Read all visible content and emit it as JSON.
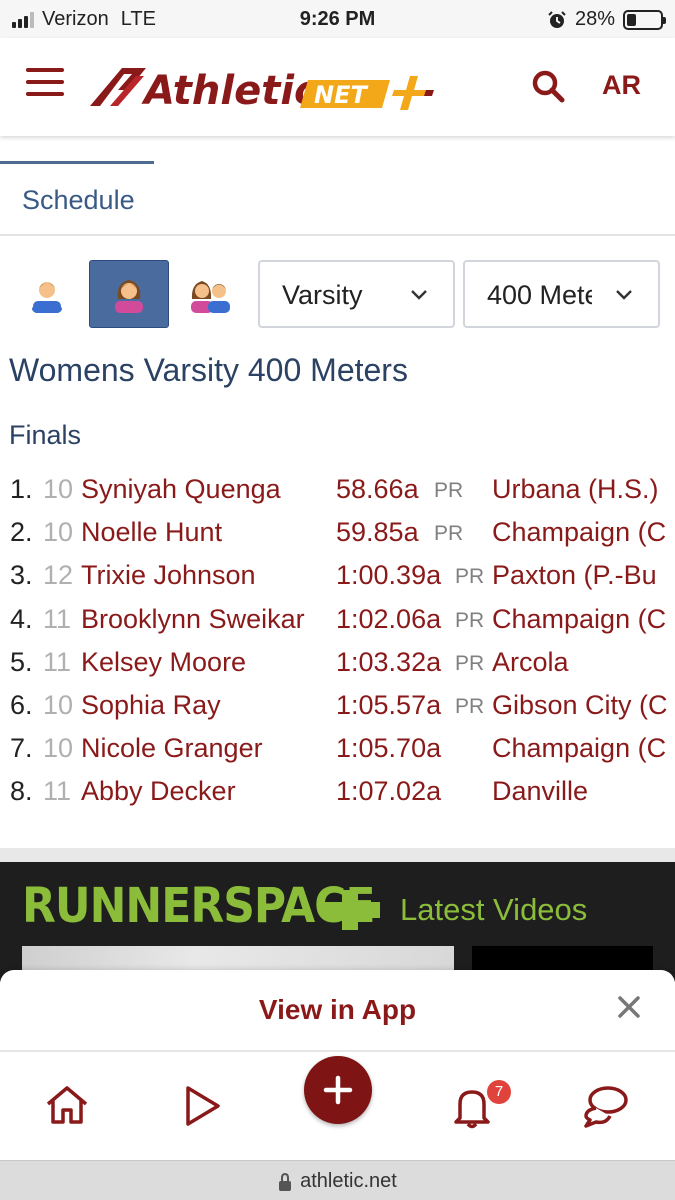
{
  "status_bar": {
    "carrier": "Verizon",
    "network": "LTE",
    "time": "9:26 PM",
    "battery": "28%",
    "battery_level": 0.28
  },
  "header": {
    "logo_athletic": "Athletic",
    "logo_net": "NET",
    "user_initials": "AR",
    "colors": {
      "brand": "#8a1a1a",
      "gold": "#f2a818"
    }
  },
  "tabs": [
    {
      "label": "Schedule"
    }
  ],
  "filters": {
    "gender_selected": "women",
    "level": "Varsity",
    "event": "400 Meters"
  },
  "event_title": "Womens Varsity 400 Meters",
  "section": "Finals",
  "results": [
    {
      "place": "1.",
      "grade": "10",
      "name": "Syniyah Quenga",
      "time": "58.66a",
      "pr": "PR",
      "team": "Urbana (H.S.)"
    },
    {
      "place": "2.",
      "grade": "10",
      "name": "Noelle Hunt",
      "time": "59.85a",
      "pr": "PR",
      "team": "Champaign (C"
    },
    {
      "place": "3.",
      "grade": "12",
      "name": "Trixie Johnson",
      "time": "1:00.39a",
      "pr": "PR",
      "team": "Paxton (P.-Bu"
    },
    {
      "place": "4.",
      "grade": "11",
      "name": "Brooklynn Sweikar",
      "time": "1:02.06a",
      "pr": "PR",
      "team": "Champaign (C"
    },
    {
      "place": "5.",
      "grade": "11",
      "name": "Kelsey Moore",
      "time": "1:03.32a",
      "pr": "PR",
      "team": "Arcola"
    },
    {
      "place": "6.",
      "grade": "10",
      "name": "Sophia Ray",
      "time": "1:05.57a",
      "pr": "PR",
      "team": "Gibson City (C"
    },
    {
      "place": "7.",
      "grade": "10",
      "name": "Nicole Granger",
      "time": "1:05.70a",
      "pr": "",
      "team": "Champaign (C"
    },
    {
      "place": "8.",
      "grade": "11",
      "name": "Abby Decker",
      "time": "1:07.02a",
      "pr": "",
      "team": "Danville"
    }
  ],
  "runnerspace": {
    "logo": "RUNNERSPACE",
    "heading": "Latest Videos",
    "accent": "#8bbd3a"
  },
  "app_banner": {
    "label": "View in App"
  },
  "bottom_nav": {
    "notifications_count": "7"
  },
  "url_bar": {
    "url": "athletic.net"
  }
}
